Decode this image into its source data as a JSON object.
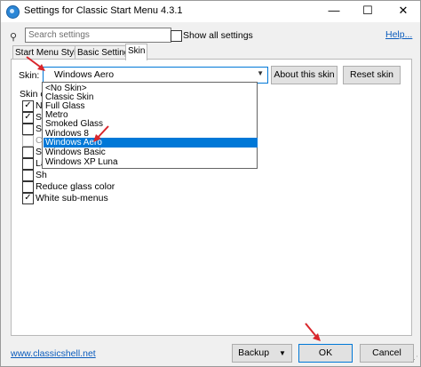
{
  "window": {
    "title": "Settings for Classic Start Menu 4.3.1"
  },
  "titlebar": {
    "minimize": "—",
    "maximize": "☐",
    "close": "✕"
  },
  "search": {
    "placeholder": "Search settings",
    "value": ""
  },
  "show_all": {
    "label": "Show all settings",
    "checked": false
  },
  "help": {
    "label": "Help..."
  },
  "tabs": [
    {
      "label": "Start Menu Style",
      "active": false
    },
    {
      "label": "Basic Settings",
      "active": false
    },
    {
      "label": "Skin",
      "active": true
    }
  ],
  "skin": {
    "label": "Skin:",
    "selected": "Windows Aero",
    "about_button": "About this skin",
    "reset_button": "Reset skin",
    "options_label": "Skin op",
    "options": [
      {
        "label": "N",
        "checked": true,
        "enabled": true
      },
      {
        "label": "Sh",
        "checked": true,
        "enabled": true
      },
      {
        "label": "Sh",
        "checked": false,
        "enabled": true
      },
      {
        "label": "C",
        "checked": false,
        "enabled": false
      },
      {
        "label": "Sn",
        "checked": false,
        "enabled": true
      },
      {
        "label": "La",
        "checked": false,
        "enabled": true
      },
      {
        "label": "Sh",
        "checked": false,
        "enabled": true
      },
      {
        "label": "Reduce glass color",
        "checked": false,
        "enabled": true
      },
      {
        "label": "White sub-menus",
        "checked": true,
        "enabled": true
      }
    ],
    "dropdown_items": [
      "<No Skin>",
      "Classic Skin",
      "Full Glass",
      "Metro",
      "Smoked Glass",
      "Windows 8",
      "Windows Aero",
      "Windows Basic",
      "Windows XP Luna"
    ],
    "highlighted_item": "Windows Aero"
  },
  "footer": {
    "website": "www.classicshell.net",
    "backup_button": "Backup",
    "ok_button": "OK",
    "cancel_button": "Cancel"
  },
  "colors": {
    "accent": "#0078d7",
    "link": "#0b5cbd",
    "arrow": "#d9262c"
  }
}
